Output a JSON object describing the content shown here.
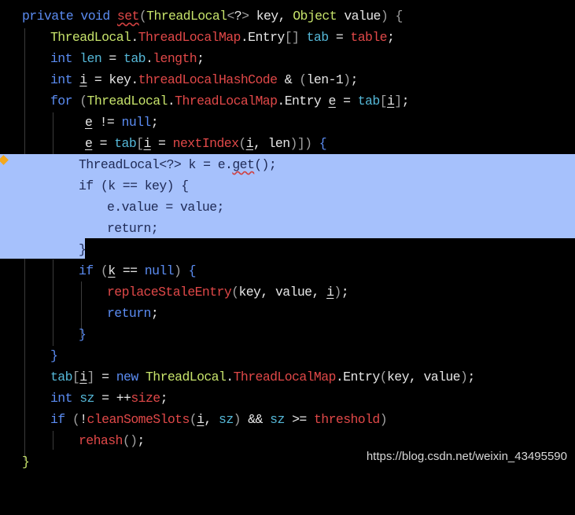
{
  "code_lines": [
    "private void set(ThreadLocal<?> key, Object value) {",
    "ThreadLocal.ThreadLocalMap.Entry[] tab = table;",
    "int len = tab.length;",
    "int i = key.threadLocalHashCode & (len-1);",
    "for (ThreadLocal.ThreadLocalMap.Entry e = tab[i];",
    "e != null;",
    "e = tab[i = nextIndex(i, len)]) {",
    "ThreadLocal<?> k = e.get();",
    "if (k == key) {",
    "e.value = value;",
    "return;",
    "}",
    "if (k == null) {",
    "replaceStaleEntry(key, value, i);",
    "return;",
    "}",
    "}",
    "tab[i] = new ThreadLocal.ThreadLocalMap.Entry(key, value);",
    "int sz = ++size;",
    "if (!cleanSomeSlots(i, sz) && sz >= threshold)",
    "rehash();",
    "}"
  ],
  "colors": {
    "background": "#000000",
    "selection": "#a6c1fc",
    "keyword": "#5b8cf2",
    "type": "#c7e36b",
    "method": "#e04848",
    "field": "#55b8d8",
    "breakpoint": "#f4a81c"
  },
  "watermark": "https://blog.csdn.net/weixin_43495590"
}
